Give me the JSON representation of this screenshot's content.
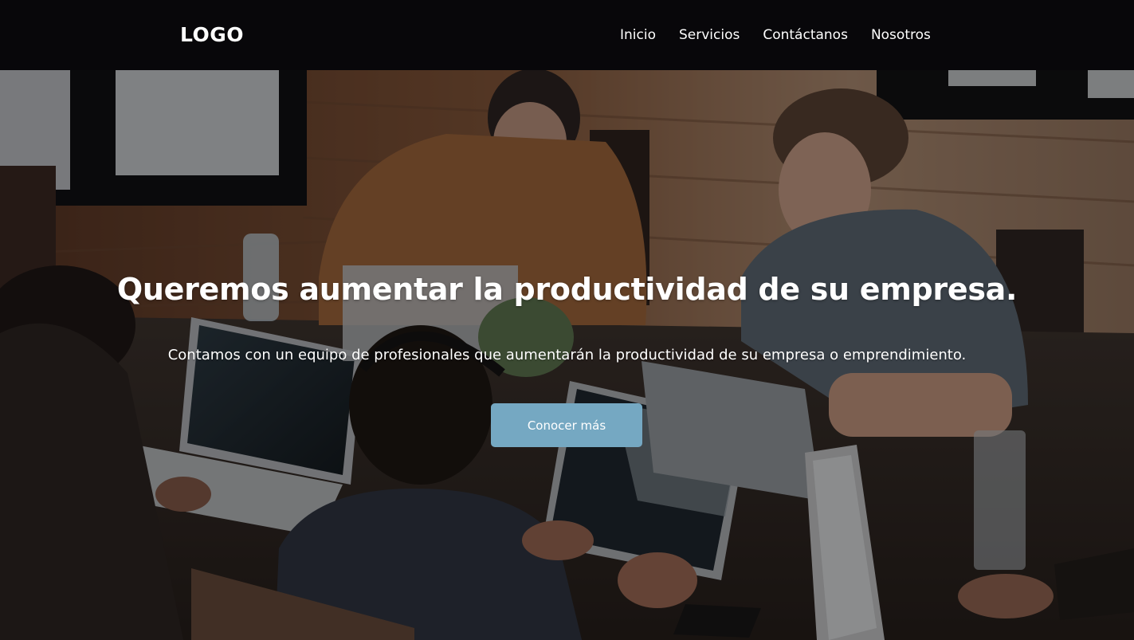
{
  "header": {
    "logo": "LOGO",
    "nav": [
      "Inicio",
      "Servicios",
      "Contáctanos",
      "Nosotros"
    ]
  },
  "hero": {
    "headline": "Queremos aumentar la productividad de su empresa.",
    "subtext": "Contamos con un equipo de profesionales que aumentarán la productividad de su empresa o emprendimiento.",
    "cta_label": "Conocer más"
  },
  "colors": {
    "navbar_bg": "#08070a",
    "cta_bg": "#75a8c2",
    "text": "#ffffff"
  }
}
